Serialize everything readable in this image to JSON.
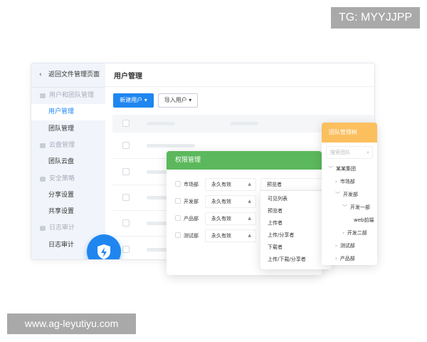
{
  "watermarks": {
    "top": "TG: MYYJJPP",
    "bottom": "www.ag-leyutiyu.com"
  },
  "colors": {
    "primary": "#1f86f0",
    "permission_header": "#5cb85c",
    "team_header": "#fbbf5e"
  },
  "sidebar": {
    "back": "返回文件管理页面",
    "items": [
      {
        "label": "用户和团队管理",
        "type": "group",
        "icon": "user-icon"
      },
      {
        "label": "用户管理",
        "type": "item",
        "active": true
      },
      {
        "label": "团队管理",
        "type": "item"
      },
      {
        "label": "云盘管理",
        "type": "group",
        "icon": "disk-icon"
      },
      {
        "label": "团队云盘",
        "type": "item"
      },
      {
        "label": "安全策略",
        "type": "group",
        "icon": "shield-icon"
      },
      {
        "label": "分享设置",
        "type": "item"
      },
      {
        "label": "共享设置",
        "type": "item"
      },
      {
        "label": "日志审计",
        "type": "group",
        "icon": "log-icon"
      },
      {
        "label": "日志审计",
        "type": "item"
      }
    ]
  },
  "header": {
    "title": "用户管理"
  },
  "toolbar": {
    "new_user": "新建用户 ▾",
    "import_user": "导入用户 ▾"
  },
  "permission": {
    "title": "权限管理",
    "rows": [
      {
        "dept": "市场部",
        "validity": "永久有效",
        "role": "预览者"
      },
      {
        "dept": "开发部",
        "validity": "永久有效"
      },
      {
        "dept": "产品部",
        "validity": "永久有效"
      },
      {
        "dept": "测试部",
        "validity": "永久有效"
      }
    ],
    "role_options": [
      "可见列表",
      "预览者",
      "上传者",
      "上传/分享者",
      "下载者",
      "上传/下载/分享者"
    ]
  },
  "team_tree": {
    "title": "团队管理树",
    "search_placeholder": "搜索团队",
    "nodes": [
      {
        "label": "某某集团",
        "level": 0,
        "arrow": "﹀"
      },
      {
        "label": "市场部",
        "level": 1,
        "arrow": "›"
      },
      {
        "label": "开发部",
        "level": 1,
        "arrow": "﹀"
      },
      {
        "label": "开发一部",
        "level": 2,
        "arrow": "﹀"
      },
      {
        "label": "web前端",
        "level": 3,
        "arrow": ""
      },
      {
        "label": "开发二部",
        "level": 2,
        "arrow": "›"
      },
      {
        "label": "测试部",
        "level": 1,
        "arrow": "›"
      },
      {
        "label": "产品部",
        "level": 1,
        "arrow": "›"
      }
    ]
  }
}
